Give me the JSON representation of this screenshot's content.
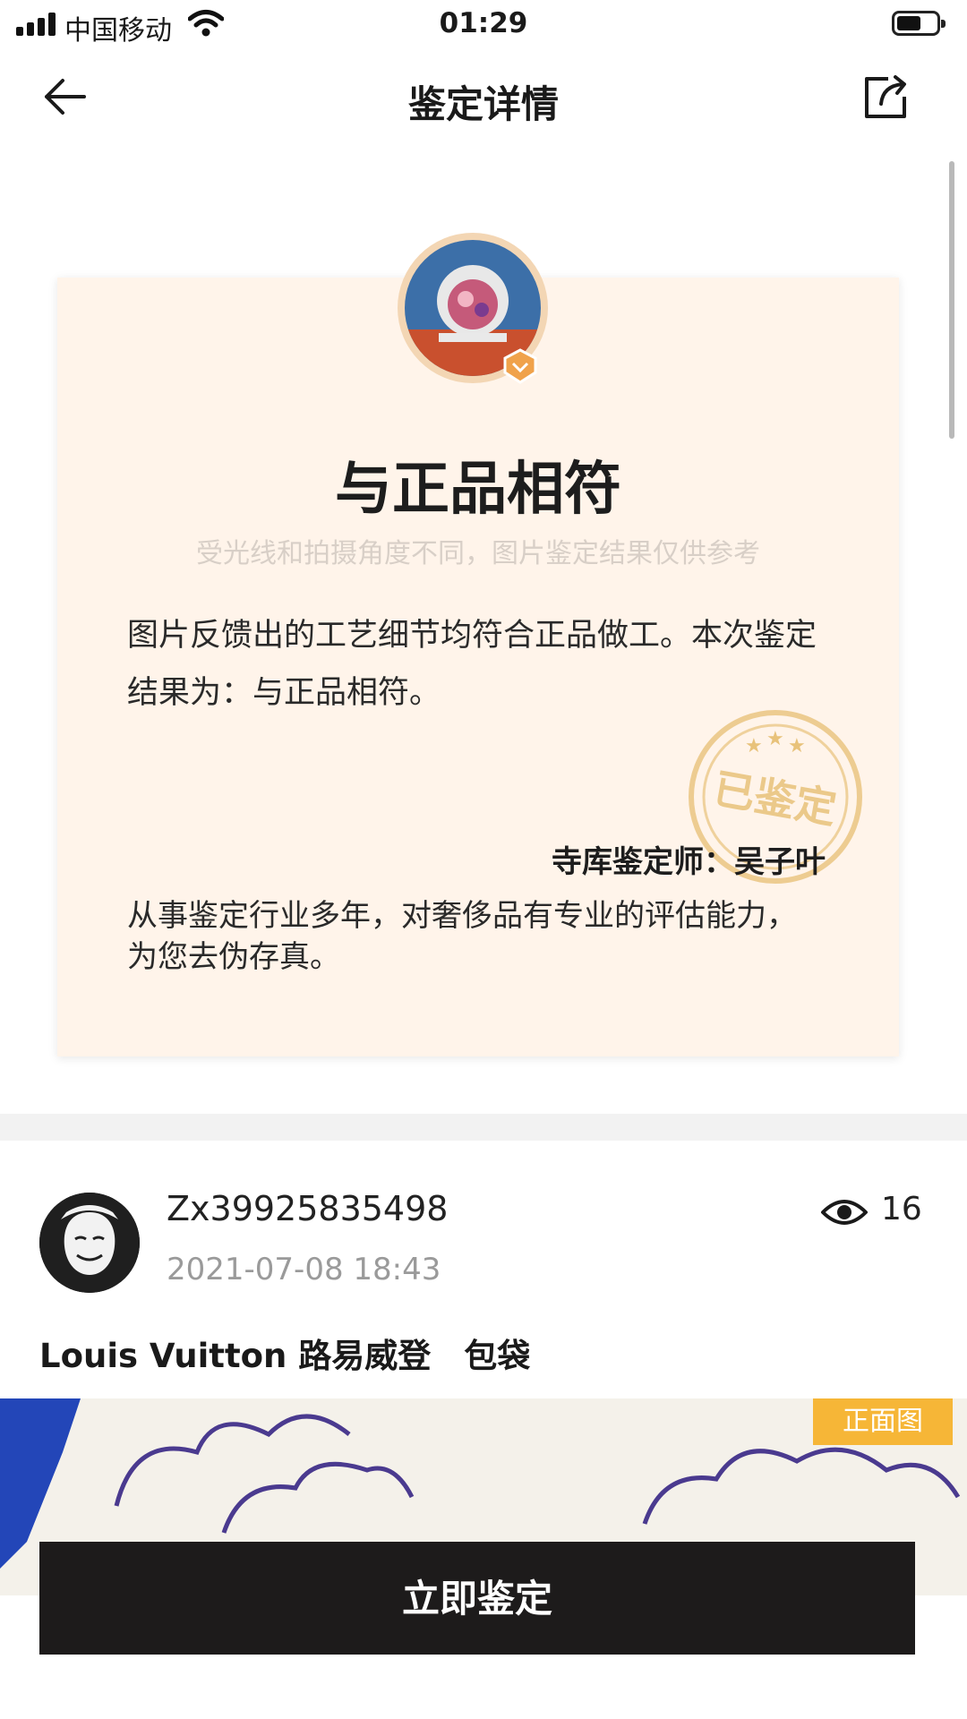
{
  "status_bar": {
    "carrier": "中国移动",
    "time": "01:29"
  },
  "nav": {
    "title": "鉴定详情",
    "back_icon": "arrow-left-icon",
    "share_icon": "share-icon"
  },
  "certificate": {
    "result": "与正品相符",
    "disclaimer": "受光线和拍摄角度不同，图片鉴定结果仅供参考",
    "description": "图片反馈出的工艺细节均符合正品做工。本次鉴定结果为：与正品相符。",
    "stamp_text": "已鉴定",
    "appraiser": "寺库鉴定师：吴子叶",
    "appraiser_bio": "从事鉴定行业多年，对奢侈品有专业的评估能力，为您去伪存真。"
  },
  "post": {
    "username": "Zx39925835498",
    "time": "2021-07-08 18:43",
    "views": "16",
    "product_title": "Louis Vuitton 路易威登　包袋",
    "photo_tag": "正面图"
  },
  "action": {
    "button_label": "立即鉴定"
  },
  "colors": {
    "card_bg": "#fff4ea",
    "stamp": "#e8c27a",
    "tag": "#f6b637",
    "button": "#1d1b1b"
  }
}
